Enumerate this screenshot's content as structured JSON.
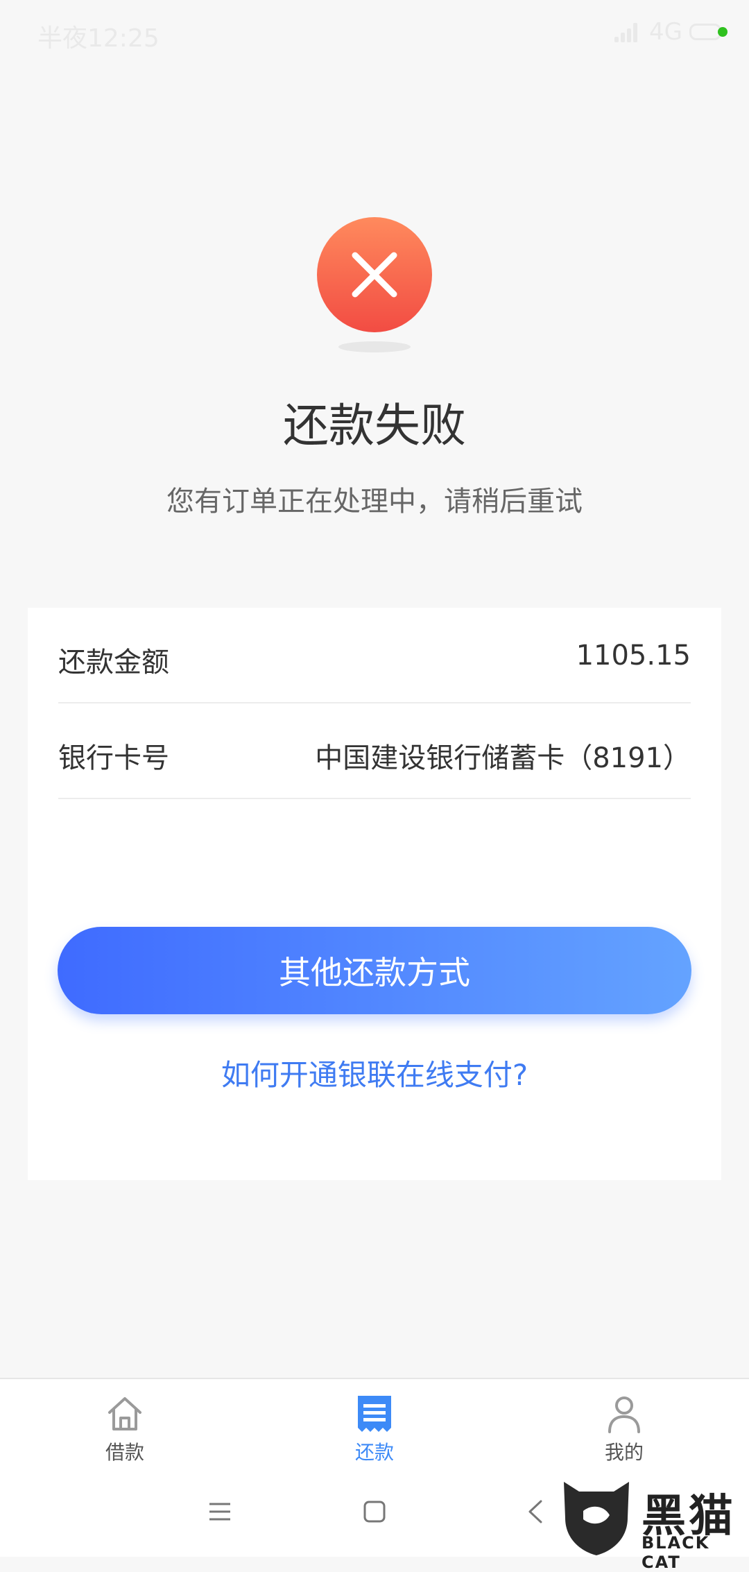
{
  "status_bar": {
    "time": "半夜12:25",
    "network": "4G"
  },
  "result": {
    "title": "还款失败",
    "message": "您有订单正在处理中，请稍后重试"
  },
  "details": {
    "amount_label": "还款金额",
    "amount_value": "1105.15",
    "card_label": "银行卡号",
    "card_value": "中国建设银行储蓄卡（8191）"
  },
  "actions": {
    "other_methods": "其他还款方式",
    "unionpay_help": "如何开通银联在线支付?"
  },
  "tabs": [
    {
      "label": "借款",
      "icon": "house-icon",
      "color": "#9a9a9a"
    },
    {
      "label": "还款",
      "icon": "bill-icon",
      "color": "#3d8af7"
    },
    {
      "label": "我的",
      "icon": "user-icon",
      "color": "#9a9a9a"
    }
  ],
  "watermark": {
    "text": "黑猫",
    "sub": "BLACK CAT"
  },
  "colors": {
    "error": "#f24c43",
    "primary": "#3f6bff",
    "link": "#3f7bf2"
  }
}
